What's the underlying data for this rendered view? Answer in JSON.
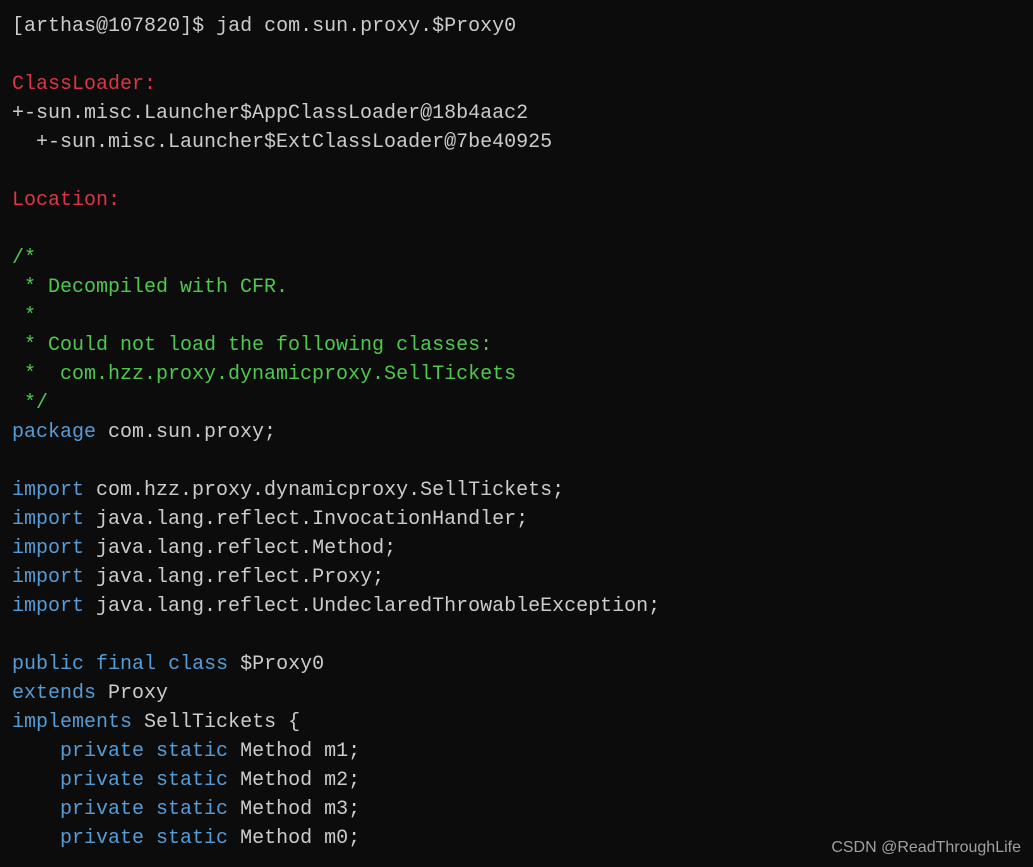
{
  "prompt": {
    "open": "[",
    "user": "arthas",
    "at": "@",
    "host": "107820",
    "close": "]",
    "dollar": "$"
  },
  "command": "jad com.sun.proxy.$Proxy0",
  "sections": {
    "classloader": "ClassLoader:",
    "location": "Location:"
  },
  "classloader": {
    "line1": "+-sun.misc.Launcher$AppClassLoader@18b4aac2",
    "line2": "  +-sun.misc.Launcher$ExtClassLoader@7be40925"
  },
  "code": {
    "comment": {
      "open": "/*",
      "decompiled": " * Decompiled with CFR.",
      "star": " *",
      "couldNotLoad": " * Could not load the following classes:",
      "className": " *  com.hzz.proxy.dynamicproxy.SellTickets",
      "close": " */"
    },
    "packageKeyword": "package",
    "packageName": "com.sun.proxy;",
    "importKeyword": "import",
    "imports": [
      "com.hzz.proxy.dynamicproxy.SellTickets;",
      "java.lang.reflect.InvocationHandler;",
      "java.lang.reflect.Method;",
      "java.lang.reflect.Proxy;",
      "java.lang.reflect.UndeclaredThrowableException;"
    ],
    "publicKeyword": "public",
    "finalKeyword": "final",
    "classKeyword": "class",
    "className": "$Proxy0",
    "extendsKeyword": "extends",
    "extendsName": "Proxy",
    "implementsKeyword": "implements",
    "implementsName": "SellTickets {",
    "privateKeyword": "private",
    "staticKeyword": "static",
    "fields": [
      "Method m1;",
      "Method m2;",
      "Method m3;",
      "Method m0;"
    ]
  },
  "watermark": "CSDN @ReadThroughLife"
}
